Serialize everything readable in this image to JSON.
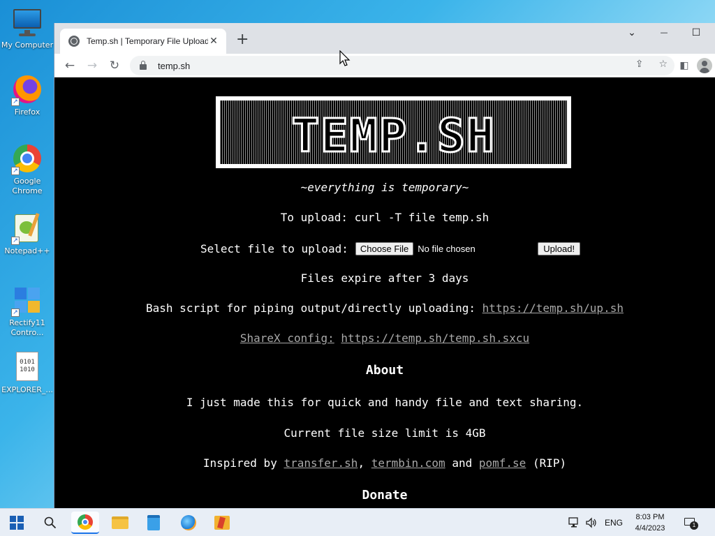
{
  "desktop": {
    "icons": [
      {
        "label": "My Computer"
      },
      {
        "label": "Firefox"
      },
      {
        "label": "Google Chrome"
      },
      {
        "label": "Notepad++"
      },
      {
        "label": "Rectify11 Contro..."
      },
      {
        "label": "EXPLORER_..."
      }
    ],
    "explorer_file_glyph": "0101\n1010"
  },
  "browser": {
    "tab_title": "Temp.sh | Temporary File Upload",
    "tab_close": "✕",
    "new_tab": "+",
    "url": "temp.sh",
    "window_controls": {
      "dropdown": "⌄",
      "minimize": "—",
      "maximize": "☐"
    }
  },
  "page": {
    "logo_text": "TEMP.SH",
    "tagline": "~everything is temporary~",
    "upload_instructions": "To upload: curl -T file temp.sh",
    "select_label": "Select file to upload:",
    "choose_file_button": "Choose File",
    "no_file_chosen": "No file chosen",
    "upload_button": "Upload!",
    "expire_text": "Files expire after 3 days",
    "bash_prefix": "Bash script for piping output/directly uploading:",
    "bash_link": "https://temp.sh/up.sh",
    "sharex_label": "ShareX config:",
    "sharex_link": "https://temp.sh/temp.sh.sxcu",
    "about_heading": "About",
    "about_text": "I just made this for quick and handy file and text sharing.",
    "size_limit": "Current file size limit is 4GB",
    "inspired_prefix": "Inspired by",
    "inspired_link1": "transfer.sh",
    "comma": ",",
    "inspired_link2": "termbin.com",
    "and_word": "and",
    "inspired_link3": "pomf.se",
    "rip": "(RIP)",
    "donate_heading": "Donate"
  },
  "taskbar": {
    "language": "ENG",
    "time": "8:03 PM",
    "date": "4/4/2023",
    "notification_count": "1"
  },
  "colors": {
    "link_gray": "#a9a9a9",
    "page_bg": "#000000",
    "taskbar_bg": "#e8eef6",
    "accent": "#1a73e8"
  }
}
